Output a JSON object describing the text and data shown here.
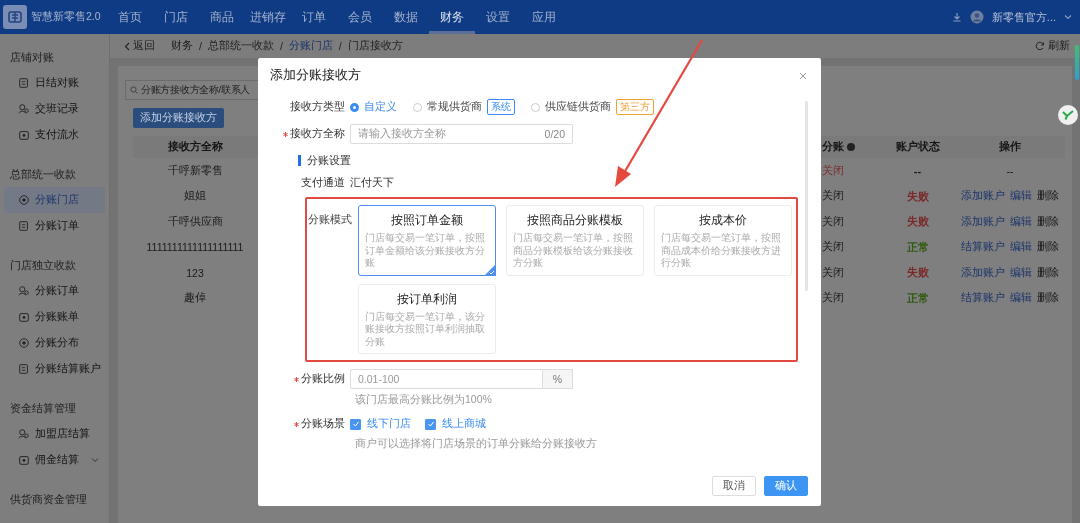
{
  "app": {
    "name": "智慧新零售2.0"
  },
  "nav": [
    {
      "label": "首页",
      "selected": false
    },
    {
      "label": "门店",
      "selected": false
    },
    {
      "label": "商品",
      "selected": false
    },
    {
      "label": "进销存",
      "selected": false
    },
    {
      "label": "订单",
      "selected": false
    },
    {
      "label": "会员",
      "selected": false
    },
    {
      "label": "数据",
      "selected": false
    },
    {
      "label": "财务",
      "selected": true
    },
    {
      "label": "设置",
      "selected": false
    },
    {
      "label": "应用",
      "selected": false
    }
  ],
  "user": {
    "name": "新零售官方..."
  },
  "sidebar": [
    {
      "title": "店铺对账",
      "items": [
        {
          "label": "日结对账",
          "selected": false,
          "expanded": false
        },
        {
          "label": "交班记录",
          "selected": false,
          "expanded": false
        },
        {
          "label": "支付流水",
          "selected": false,
          "expanded": false
        }
      ]
    },
    {
      "title": "总部统一收款",
      "items": [
        {
          "label": "分账门店",
          "selected": true,
          "expanded": false
        },
        {
          "label": "分账订单",
          "selected": false,
          "expanded": false
        }
      ]
    },
    {
      "title": "门店独立收款",
      "items": [
        {
          "label": "分账订单",
          "selected": false,
          "expanded": false
        },
        {
          "label": "分账账单",
          "selected": false,
          "expanded": false
        },
        {
          "label": "分账分布",
          "selected": false,
          "expanded": false
        },
        {
          "label": "分账结算账户",
          "selected": false,
          "expanded": false
        }
      ]
    },
    {
      "title": "资金结算管理",
      "items": [
        {
          "label": "加盟店结算",
          "selected": false,
          "expanded": false
        },
        {
          "label": "佣金结算",
          "selected": false,
          "expanded": true
        }
      ]
    },
    {
      "title": "供货商资金管理"
    }
  ],
  "breadcrumb": {
    "back": "返回",
    "separator": "/",
    "path": [
      {
        "label": "财务",
        "kind": "text"
      },
      {
        "label": "总部统一收款",
        "kind": "text"
      },
      {
        "label": "分账门店",
        "kind": "link"
      },
      {
        "label": "门店接收方",
        "kind": "text"
      }
    ]
  },
  "refresh": "刷新",
  "list": {
    "search_placeholder": "分账方接收方全称/联系人",
    "add_button": "添加分账接收方",
    "columns": [
      "接收方全称",
      "分账",
      "账户状态",
      "操作"
    ],
    "rows": [
      {
        "name": "千呼新零售",
        "split": {
          "text": "关闭",
          "color": "#7a2a2a"
        },
        "status": {
          "text": "--",
          "color": "#1a1a1a"
        },
        "actions": [
          {
            "label": "--",
            "kind": "text"
          }
        ]
      },
      {
        "name": "姐姐",
        "split": {
          "text": "关闭",
          "color": "#1a1a1a"
        },
        "status": {
          "text": "失败",
          "color": "#7a2a2a"
        },
        "actions": [
          {
            "label": "添加账户",
            "kind": "link"
          },
          {
            "label": "编辑",
            "kind": "link"
          },
          {
            "label": "删除",
            "kind": "text"
          }
        ]
      },
      {
        "name": "千呼供应商",
        "split": {
          "text": "关闭",
          "color": "#1a1a1a"
        },
        "status": {
          "text": "失败",
          "color": "#7a2a2a"
        },
        "actions": [
          {
            "label": "添加账户",
            "kind": "link"
          },
          {
            "label": "编辑",
            "kind": "link"
          },
          {
            "label": "删除",
            "kind": "text"
          }
        ]
      },
      {
        "name": "1111111111111111111",
        "split": {
          "text": "关闭",
          "color": "#1a1a1a"
        },
        "status": {
          "text": "正常",
          "color": "#2f5a10"
        },
        "actions": [
          {
            "label": "结算账户",
            "kind": "link"
          },
          {
            "label": "编辑",
            "kind": "link"
          },
          {
            "label": "删除",
            "kind": "text"
          }
        ]
      },
      {
        "name": "123",
        "split": {
          "text": "关闭",
          "color": "#1a1a1a"
        },
        "status": {
          "text": "失败",
          "color": "#7a2a2a"
        },
        "actions": [
          {
            "label": "添加账户",
            "kind": "link"
          },
          {
            "label": "编辑",
            "kind": "link"
          },
          {
            "label": "删除",
            "kind": "text"
          }
        ]
      },
      {
        "name": "趣倬",
        "split": {
          "text": "关闭",
          "color": "#1a1a1a"
        },
        "status": {
          "text": "正常",
          "color": "#2f5a10"
        },
        "actions": [
          {
            "label": "结算账户",
            "kind": "link"
          },
          {
            "label": "编辑",
            "kind": "link"
          },
          {
            "label": "删除",
            "kind": "text"
          }
        ]
      }
    ]
  },
  "dialog": {
    "title": "添加分账接收方",
    "receiver_type": {
      "label": "接收方类型",
      "options": [
        {
          "label": "自定义",
          "selected": true
        },
        {
          "label": "常规供货商",
          "selected": false,
          "tag": {
            "text": "系统",
            "color": "#3b8cf0"
          }
        },
        {
          "label": "供应链供货商",
          "selected": false,
          "tag": {
            "text": "第三方",
            "color": "#f0a030"
          }
        }
      ]
    },
    "name_field": {
      "label": "接收方全称",
      "required": true,
      "placeholder": "请输入接收方全称",
      "counter": "0/20"
    },
    "section": "分账设置",
    "channel": {
      "label": "支付通道",
      "value": "汇付天下"
    },
    "mode": {
      "label": "分账模式",
      "options": [
        {
          "title": "按照订单金额",
          "description": "门店每交易一笔订单，按照订单金额给该分账接收方分账",
          "selected": true
        },
        {
          "title": "按照商品分账模板",
          "description": "门店每交易一笔订单，按照商品分账模板给该分账接收方分账",
          "selected": false
        },
        {
          "title": "按成本价",
          "description": "门店每交易一笔订单，按照商品成本价给分账接收方进行分账",
          "selected": false
        },
        {
          "title": "按订单利润",
          "description": "门店每交易一笔订单，该分账接收方按照订单利润抽取分账",
          "selected": false
        }
      ]
    },
    "ratio": {
      "label": "分账比例",
      "required": true,
      "placeholder": "0.01-100",
      "suffix": "%",
      "hint": "该门店最高分账比例为100%"
    },
    "scene": {
      "label": "分账场景",
      "required": true,
      "options": [
        {
          "label": "线下门店",
          "checked": true
        },
        {
          "label": "线上商城",
          "checked": true
        }
      ],
      "hint": "商户可以选择将门店场景的订单分账给分账接收方"
    },
    "buttons": [
      {
        "label": "取消",
        "kind": "secondary"
      },
      {
        "label": "确认",
        "kind": "primary"
      }
    ]
  }
}
